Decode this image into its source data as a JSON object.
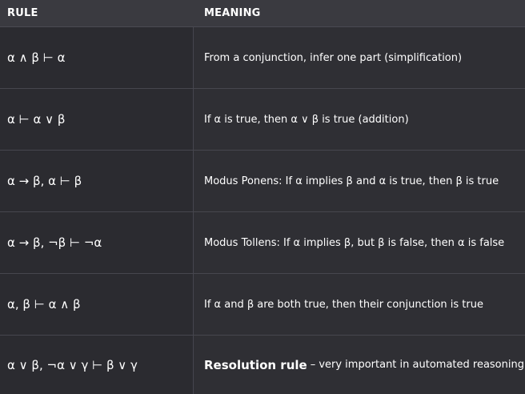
{
  "header": {
    "rule": "RULE",
    "meaning": "MEANING"
  },
  "rows": [
    {
      "rule": "α ∧ β ⊢ α",
      "meaning_bold": "",
      "meaning": "From a conjunction, infer one part (simplification)"
    },
    {
      "rule": "α ⊢ α ∨ β",
      "meaning_bold": "",
      "meaning": "If α is true, then α ∨ β is true (addition)"
    },
    {
      "rule": "α → β, α ⊢ β",
      "meaning_bold": "",
      "meaning": "Modus Ponens: If α implies β and α is true, then β is true"
    },
    {
      "rule": "α → β, ¬β ⊢ ¬α",
      "meaning_bold": "",
      "meaning": "Modus Tollens: If α implies β, but β is false, then α is false"
    },
    {
      "rule": "α, β ⊢ α ∧ β",
      "meaning_bold": "",
      "meaning": "If α and β are both true, then their conjunction is true"
    },
    {
      "rule": "α ∨ β, ¬α ∨ γ ⊢ β ∨ γ",
      "meaning_bold": "Resolution rule",
      "meaning": "– very important in automated reasoning"
    }
  ]
}
